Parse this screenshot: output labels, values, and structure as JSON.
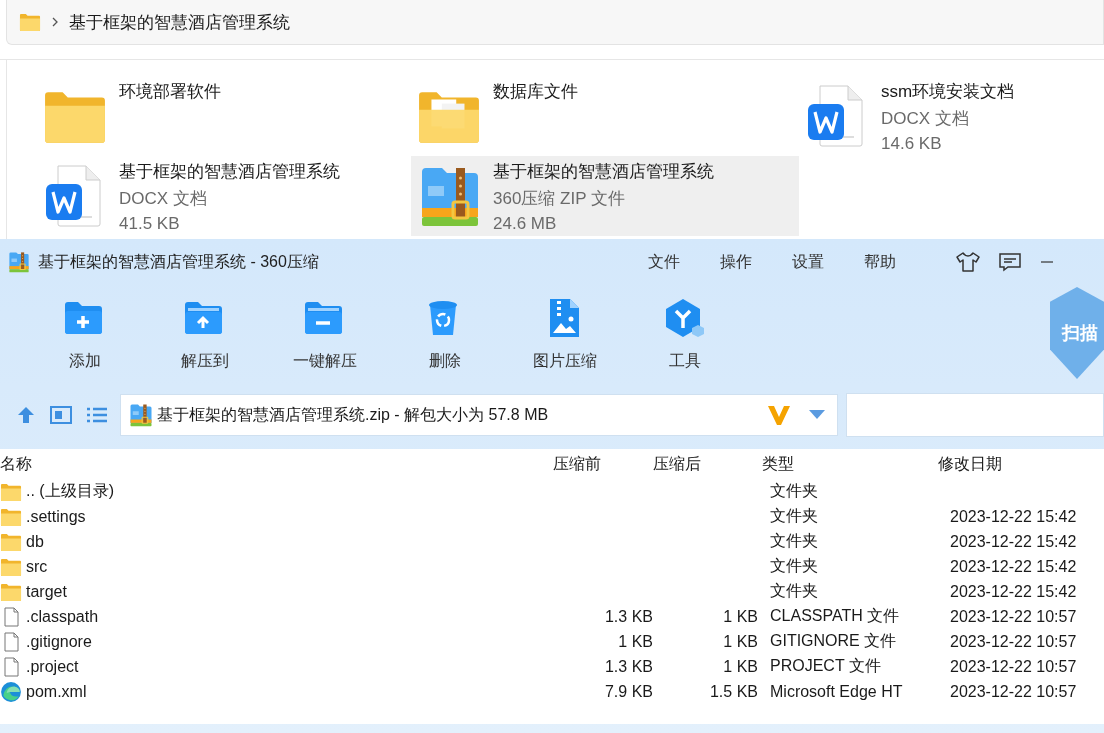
{
  "explorer": {
    "breadcrumb": "基于框架的智慧酒店管理系统",
    "items": [
      {
        "kind": "folder",
        "name": "环境部署软件",
        "selected": false
      },
      {
        "kind": "folder-docs",
        "name": "数据库文件",
        "selected": false
      },
      {
        "kind": "docx",
        "name": "ssm环境安装文档",
        "type": "DOCX 文档",
        "size": "14.6 KB",
        "selected": false
      },
      {
        "kind": "docx",
        "name": "基于框架的智慧酒店管理系统",
        "type": "DOCX 文档",
        "size": "41.5 KB",
        "selected": false
      },
      {
        "kind": "zip",
        "name": "基于框架的智慧酒店管理系统",
        "type": "360压缩 ZIP 文件",
        "size": "24.6 MB",
        "selected": true
      }
    ]
  },
  "archiver": {
    "title": "基于框架的智慧酒店管理系统 - 360压缩",
    "menu": [
      "文件",
      "操作",
      "设置",
      "帮助"
    ],
    "toolbar": [
      {
        "kind": "add",
        "label": "添加"
      },
      {
        "kind": "extract-to",
        "label": "解压到"
      },
      {
        "kind": "extract",
        "label": "一键解压"
      },
      {
        "kind": "delete",
        "label": "删除"
      },
      {
        "kind": "image",
        "label": "图片压缩"
      },
      {
        "kind": "tools",
        "label": "工具"
      }
    ],
    "scan_label": "扫描",
    "address": "基于框架的智慧酒店管理系统.zip - 解包大小为 57.8 MB",
    "columns": [
      "名称",
      "压缩前",
      "压缩后",
      "类型",
      "修改日期"
    ],
    "rows": [
      {
        "kind": "parent",
        "name": ".. (上级目录)",
        "type": "文件夹"
      },
      {
        "kind": "folder",
        "name": ".settings",
        "type": "文件夹",
        "modified": "2023-12-22 15:42"
      },
      {
        "kind": "folder",
        "name": "db",
        "type": "文件夹",
        "modified": "2023-12-22 15:42"
      },
      {
        "kind": "folder",
        "name": "src",
        "type": "文件夹",
        "modified": "2023-12-22 15:42"
      },
      {
        "kind": "folder",
        "name": "target",
        "type": "文件夹",
        "modified": "2023-12-22 15:42"
      },
      {
        "kind": "file",
        "name": ".classpath",
        "before": "1.3 KB",
        "after": "1 KB",
        "type": "CLASSPATH 文件",
        "modified": "2023-12-22 10:57"
      },
      {
        "kind": "file",
        "name": ".gitignore",
        "before": "1 KB",
        "after": "1 KB",
        "type": "GITIGNORE 文件",
        "modified": "2023-12-22 10:57"
      },
      {
        "kind": "file",
        "name": ".project",
        "before": "1.3 KB",
        "after": "1 KB",
        "type": "PROJECT 文件",
        "modified": "2023-12-22 10:57"
      },
      {
        "kind": "edge",
        "name": "pom.xml",
        "before": "7.9 KB",
        "after": "1.5 KB",
        "type": "Microsoft Edge HT",
        "modified": "2023-12-22 10:57"
      }
    ]
  }
}
